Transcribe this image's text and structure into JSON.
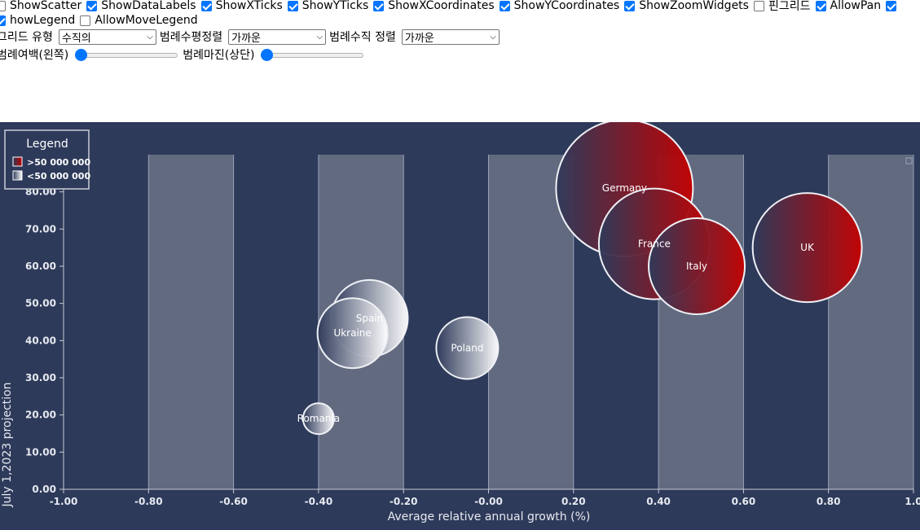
{
  "controls": {
    "checkboxes_row1": [
      {
        "label": "ShowScatter",
        "checked": false
      },
      {
        "label": "ShowDataLabels",
        "checked": true
      },
      {
        "label": "ShowXTicks",
        "checked": true
      },
      {
        "label": "ShowYTicks",
        "checked": true
      },
      {
        "label": "ShowXCoordinates",
        "checked": true
      },
      {
        "label": "ShowYCoordinates",
        "checked": true
      },
      {
        "label": "ShowZoomWidgets",
        "checked": true
      },
      {
        "label": "핀그리드",
        "checked": false
      },
      {
        "label": "AllowPan",
        "checked": true
      },
      {
        "label": "",
        "checked": true
      }
    ],
    "checkboxes_row2": [
      {
        "label": "howLegend",
        "checked": true
      },
      {
        "label": "AllowMoveLegend",
        "checked": false
      }
    ],
    "grid_type_label": "그리드 유형",
    "grid_type_value": "수직의",
    "legend_h_align_label": "범례수평정렬",
    "legend_h_align_value": "가까운",
    "legend_v_align_label": "범례수직 정렬",
    "legend_v_align_value": "가까운",
    "legend_margin_left_label": "범례여백(왼쪽)",
    "legend_margin_top_label": "범례마진(상단)"
  },
  "colors": {
    "background": "#2e3a5a",
    "band": "#626a80",
    "large": "#c40000",
    "small": "#ffffff"
  },
  "legend": {
    "title": "Legend",
    "items": [
      {
        "label": ">50 000 000",
        "color": "#c40000"
      },
      {
        "label": "<50 000 000",
        "color": "#ffffff"
      }
    ]
  },
  "chart_data": {
    "type": "scatter",
    "subtype": "bubble",
    "xlabel": "Average relative annual growth (%)",
    "ylabel": "July 1,2023 projection",
    "xlim": [
      -1.0,
      1.0
    ],
    "ylim": [
      0,
      90
    ],
    "x_ticks": [
      "-1.00",
      "-0.80",
      "-0.60",
      "-0.40",
      "-0.20",
      "-0.00",
      "0.20",
      "0.40",
      "0.60",
      "0.80",
      "1.0"
    ],
    "y_ticks": [
      "0.00",
      "10.00",
      "20.00",
      "30.00",
      "40.00",
      "50.00",
      "60.00",
      "70.00",
      "80.00"
    ],
    "grid": "vertical bands",
    "legend_position": "top-left",
    "series": [
      {
        "name": ">50 000 000",
        "points": [
          {
            "label": "Germany",
            "x": 0.32,
            "y": 81,
            "r": 84
          },
          {
            "label": "France",
            "x": 0.39,
            "y": 66,
            "r": 68
          },
          {
            "label": "Italy",
            "x": 0.49,
            "y": 60,
            "r": 59
          },
          {
            "label": "UK",
            "x": 0.75,
            "y": 65,
            "r": 67
          }
        ]
      },
      {
        "name": "<50 000 000",
        "points": [
          {
            "label": "Spain",
            "x": -0.28,
            "y": 46,
            "r": 47
          },
          {
            "label": "Ukraine",
            "x": -0.32,
            "y": 42,
            "r": 43
          },
          {
            "label": "Poland",
            "x": -0.05,
            "y": 38,
            "r": 38
          },
          {
            "label": "Romania",
            "x": -0.4,
            "y": 19,
            "r": 19
          }
        ]
      }
    ]
  }
}
